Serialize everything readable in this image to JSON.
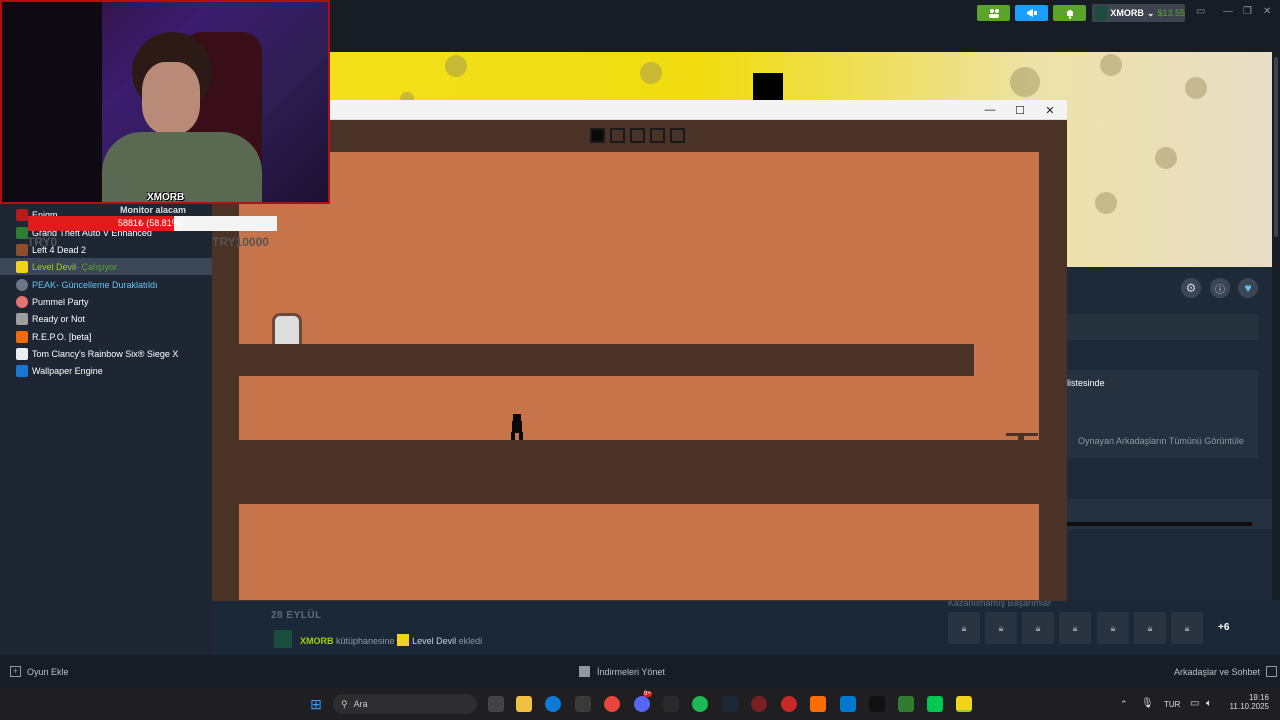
{
  "steam": {
    "account_name": "XMORB",
    "balance": "$13.55",
    "chevron": "⌄",
    "friends_icon": "friends-icon",
    "announce_icon": "megaphone-icon",
    "bell_icon": "bell-icon"
  },
  "overlay": {
    "streamer_name": "XMORB",
    "goal_label": "Monitor alacam",
    "goal_value": "5881₺ (58.81%)",
    "goal_progress": 0.5881,
    "try_left": "TRY0",
    "try_right": "TRY10000"
  },
  "sidebar": {
    "items": [
      {
        "name": "Enigm",
        "status": ""
      },
      {
        "name": "Grand Theft Auto V Enhanced",
        "status": ""
      },
      {
        "name": "Left 4 Dead 2",
        "status": ""
      },
      {
        "name": "Level Devil",
        "status": " - Çalışıyor"
      },
      {
        "name": "PEAK",
        "status": " - Güncelleme Duraklatıldı"
      },
      {
        "name": "Pummel Party",
        "status": ""
      },
      {
        "name": "Ready or Not",
        "status": ""
      },
      {
        "name": "R.E.P.O. [beta]",
        "status": ""
      },
      {
        "name": "Tom Clancy's Rainbow Six® Siege X",
        "status": ""
      },
      {
        "name": "Wallpaper Engine",
        "status": ""
      }
    ]
  },
  "right_panel": {
    "friends_list_text": "listesinde",
    "view_all_friends": "Oynayan Arkadaşların Tümünü Görüntüle",
    "achievements_label": "Kazanılmamış Başarımlar",
    "more_achievements": "+6"
  },
  "activity": {
    "date": "28 EYLÜL",
    "user": "XMORB",
    "middle_text": " kütüphanesine ",
    "game": "Level Devil",
    "end_text": " ekledi"
  },
  "footer": {
    "add_game": "Oyun Ekle",
    "manage_downloads": "İndirmeleri Yönet",
    "friends_chat": "Arkadaşlar ve Sohbet"
  },
  "game": {
    "levels_total": 5,
    "levels_completed": 1
  },
  "taskbar": {
    "search_placeholder": "Ara",
    "language": "TUR",
    "time": "19:16",
    "date": "11.10.2025",
    "discord_badge": "9+"
  },
  "colors": {
    "steam_bg": "#1b2838",
    "sidebar_bg": "#1e2633",
    "running_green": "#5ba32b",
    "paused_blue": "#67c1f5",
    "game_orange": "#c8744a",
    "game_dark": "#4a3227",
    "goal_red": "#e01b1b"
  }
}
